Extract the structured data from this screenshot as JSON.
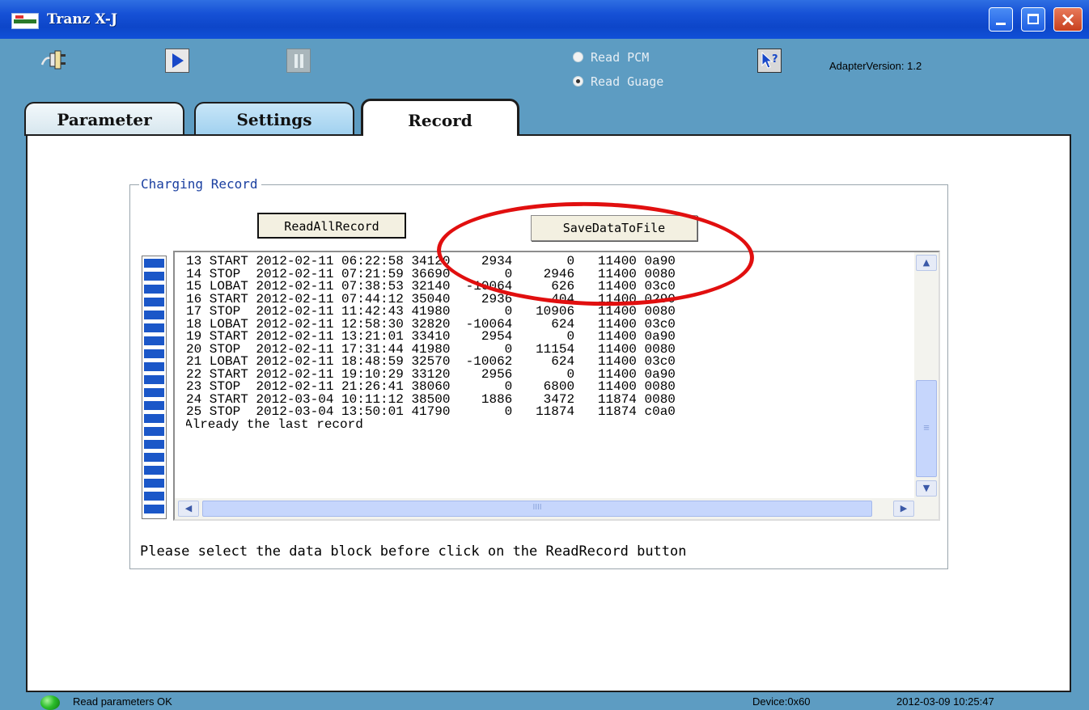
{
  "window": {
    "title": "Tranz X-J",
    "controls": {
      "minimize": "minimize",
      "maximize": "maximize",
      "close": "×"
    }
  },
  "toolbar": {
    "icons": [
      "connect-icon",
      "play-icon",
      "pause-icon",
      "help-icon"
    ],
    "read_options": [
      {
        "label": "Read PCM",
        "selected": false
      },
      {
        "label": "Read Guage",
        "selected": true
      }
    ],
    "help_label": "?",
    "adapter_version": "AdapterVersion: 1.2"
  },
  "tabs": [
    {
      "label": "Parameter",
      "active": false
    },
    {
      "label": "Settings",
      "active": false
    },
    {
      "label": "Record",
      "active": true
    }
  ],
  "record": {
    "group_title": "Charging Record",
    "read_all_label": "ReadAllRecord",
    "save_label": "SaveDataToFile",
    "log_lines": [
      "13 START 2012-02-11 06:22:58 34120    2934       0   11400 0a90",
      "14 STOP  2012-02-11 07:21:59 36690       0    2946   11400 0080",
      "15 LOBAT 2012-02-11 07:38:53 32140  -10064     626   11400 03c0",
      "16 START 2012-02-11 07:44:12 35040    2936     404   11400 0290",
      "17 STOP  2012-02-11 11:42:43 41980       0   10906   11400 0080",
      "18 LOBAT 2012-02-11 12:58:30 32820  -10064     624   11400 03c0",
      "19 START 2012-02-11 13:21:01 33410    2954       0   11400 0a90",
      "20 STOP  2012-02-11 17:31:44 41980       0   11154   11400 0080",
      "21 LOBAT 2012-02-11 18:48:59 32570  -10062     624   11400 03c0",
      "22 START 2012-02-11 19:10:29 33120    2956       0   11400 0a90",
      "23 STOP  2012-02-11 21:26:41 38060       0    6800   11400 0080",
      "24 START 2012-03-04 10:11:12 38500    1886    3472   11874 0080",
      "25 STOP  2012-03-04 13:50:01 41790       0   11874   11874 c0a0"
    ],
    "last_record_text": "Already the last record",
    "hint": "Please select the data block  before click on the ReadRecord button",
    "block_progress": {
      "filled": 20,
      "total": 20
    },
    "scrollbar": {
      "up": "▲",
      "down": "▼",
      "left": "◀",
      "right": "▶"
    },
    "annotation_color": "#e10f0f"
  },
  "status": {
    "message": "Read parameters OK",
    "device": "Device:0x60",
    "datetime": "2012-03-09 10:25:47",
    "led_color": "#2bbd2b"
  }
}
